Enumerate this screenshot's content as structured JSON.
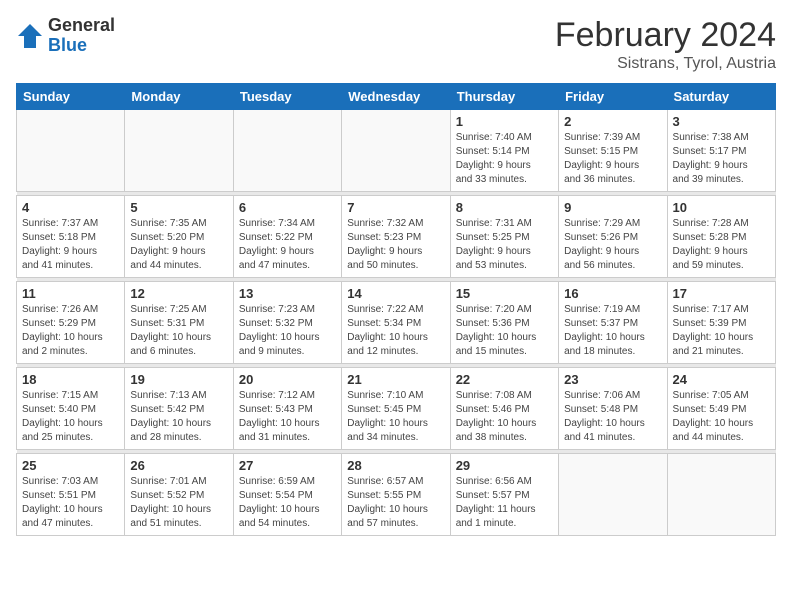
{
  "header": {
    "logo_general": "General",
    "logo_blue": "Blue",
    "month_year": "February 2024",
    "location": "Sistrans, Tyrol, Austria"
  },
  "weekdays": [
    "Sunday",
    "Monday",
    "Tuesday",
    "Wednesday",
    "Thursday",
    "Friday",
    "Saturday"
  ],
  "weeks": [
    [
      {
        "day": "",
        "info": ""
      },
      {
        "day": "",
        "info": ""
      },
      {
        "day": "",
        "info": ""
      },
      {
        "day": "",
        "info": ""
      },
      {
        "day": "1",
        "info": "Sunrise: 7:40 AM\nSunset: 5:14 PM\nDaylight: 9 hours\nand 33 minutes."
      },
      {
        "day": "2",
        "info": "Sunrise: 7:39 AM\nSunset: 5:15 PM\nDaylight: 9 hours\nand 36 minutes."
      },
      {
        "day": "3",
        "info": "Sunrise: 7:38 AM\nSunset: 5:17 PM\nDaylight: 9 hours\nand 39 minutes."
      }
    ],
    [
      {
        "day": "4",
        "info": "Sunrise: 7:37 AM\nSunset: 5:18 PM\nDaylight: 9 hours\nand 41 minutes."
      },
      {
        "day": "5",
        "info": "Sunrise: 7:35 AM\nSunset: 5:20 PM\nDaylight: 9 hours\nand 44 minutes."
      },
      {
        "day": "6",
        "info": "Sunrise: 7:34 AM\nSunset: 5:22 PM\nDaylight: 9 hours\nand 47 minutes."
      },
      {
        "day": "7",
        "info": "Sunrise: 7:32 AM\nSunset: 5:23 PM\nDaylight: 9 hours\nand 50 minutes."
      },
      {
        "day": "8",
        "info": "Sunrise: 7:31 AM\nSunset: 5:25 PM\nDaylight: 9 hours\nand 53 minutes."
      },
      {
        "day": "9",
        "info": "Sunrise: 7:29 AM\nSunset: 5:26 PM\nDaylight: 9 hours\nand 56 minutes."
      },
      {
        "day": "10",
        "info": "Sunrise: 7:28 AM\nSunset: 5:28 PM\nDaylight: 9 hours\nand 59 minutes."
      }
    ],
    [
      {
        "day": "11",
        "info": "Sunrise: 7:26 AM\nSunset: 5:29 PM\nDaylight: 10 hours\nand 2 minutes."
      },
      {
        "day": "12",
        "info": "Sunrise: 7:25 AM\nSunset: 5:31 PM\nDaylight: 10 hours\nand 6 minutes."
      },
      {
        "day": "13",
        "info": "Sunrise: 7:23 AM\nSunset: 5:32 PM\nDaylight: 10 hours\nand 9 minutes."
      },
      {
        "day": "14",
        "info": "Sunrise: 7:22 AM\nSunset: 5:34 PM\nDaylight: 10 hours\nand 12 minutes."
      },
      {
        "day": "15",
        "info": "Sunrise: 7:20 AM\nSunset: 5:36 PM\nDaylight: 10 hours\nand 15 minutes."
      },
      {
        "day": "16",
        "info": "Sunrise: 7:19 AM\nSunset: 5:37 PM\nDaylight: 10 hours\nand 18 minutes."
      },
      {
        "day": "17",
        "info": "Sunrise: 7:17 AM\nSunset: 5:39 PM\nDaylight: 10 hours\nand 21 minutes."
      }
    ],
    [
      {
        "day": "18",
        "info": "Sunrise: 7:15 AM\nSunset: 5:40 PM\nDaylight: 10 hours\nand 25 minutes."
      },
      {
        "day": "19",
        "info": "Sunrise: 7:13 AM\nSunset: 5:42 PM\nDaylight: 10 hours\nand 28 minutes."
      },
      {
        "day": "20",
        "info": "Sunrise: 7:12 AM\nSunset: 5:43 PM\nDaylight: 10 hours\nand 31 minutes."
      },
      {
        "day": "21",
        "info": "Sunrise: 7:10 AM\nSunset: 5:45 PM\nDaylight: 10 hours\nand 34 minutes."
      },
      {
        "day": "22",
        "info": "Sunrise: 7:08 AM\nSunset: 5:46 PM\nDaylight: 10 hours\nand 38 minutes."
      },
      {
        "day": "23",
        "info": "Sunrise: 7:06 AM\nSunset: 5:48 PM\nDaylight: 10 hours\nand 41 minutes."
      },
      {
        "day": "24",
        "info": "Sunrise: 7:05 AM\nSunset: 5:49 PM\nDaylight: 10 hours\nand 44 minutes."
      }
    ],
    [
      {
        "day": "25",
        "info": "Sunrise: 7:03 AM\nSunset: 5:51 PM\nDaylight: 10 hours\nand 47 minutes."
      },
      {
        "day": "26",
        "info": "Sunrise: 7:01 AM\nSunset: 5:52 PM\nDaylight: 10 hours\nand 51 minutes."
      },
      {
        "day": "27",
        "info": "Sunrise: 6:59 AM\nSunset: 5:54 PM\nDaylight: 10 hours\nand 54 minutes."
      },
      {
        "day": "28",
        "info": "Sunrise: 6:57 AM\nSunset: 5:55 PM\nDaylight: 10 hours\nand 57 minutes."
      },
      {
        "day": "29",
        "info": "Sunrise: 6:56 AM\nSunset: 5:57 PM\nDaylight: 11 hours\nand 1 minute."
      },
      {
        "day": "",
        "info": ""
      },
      {
        "day": "",
        "info": ""
      }
    ]
  ]
}
